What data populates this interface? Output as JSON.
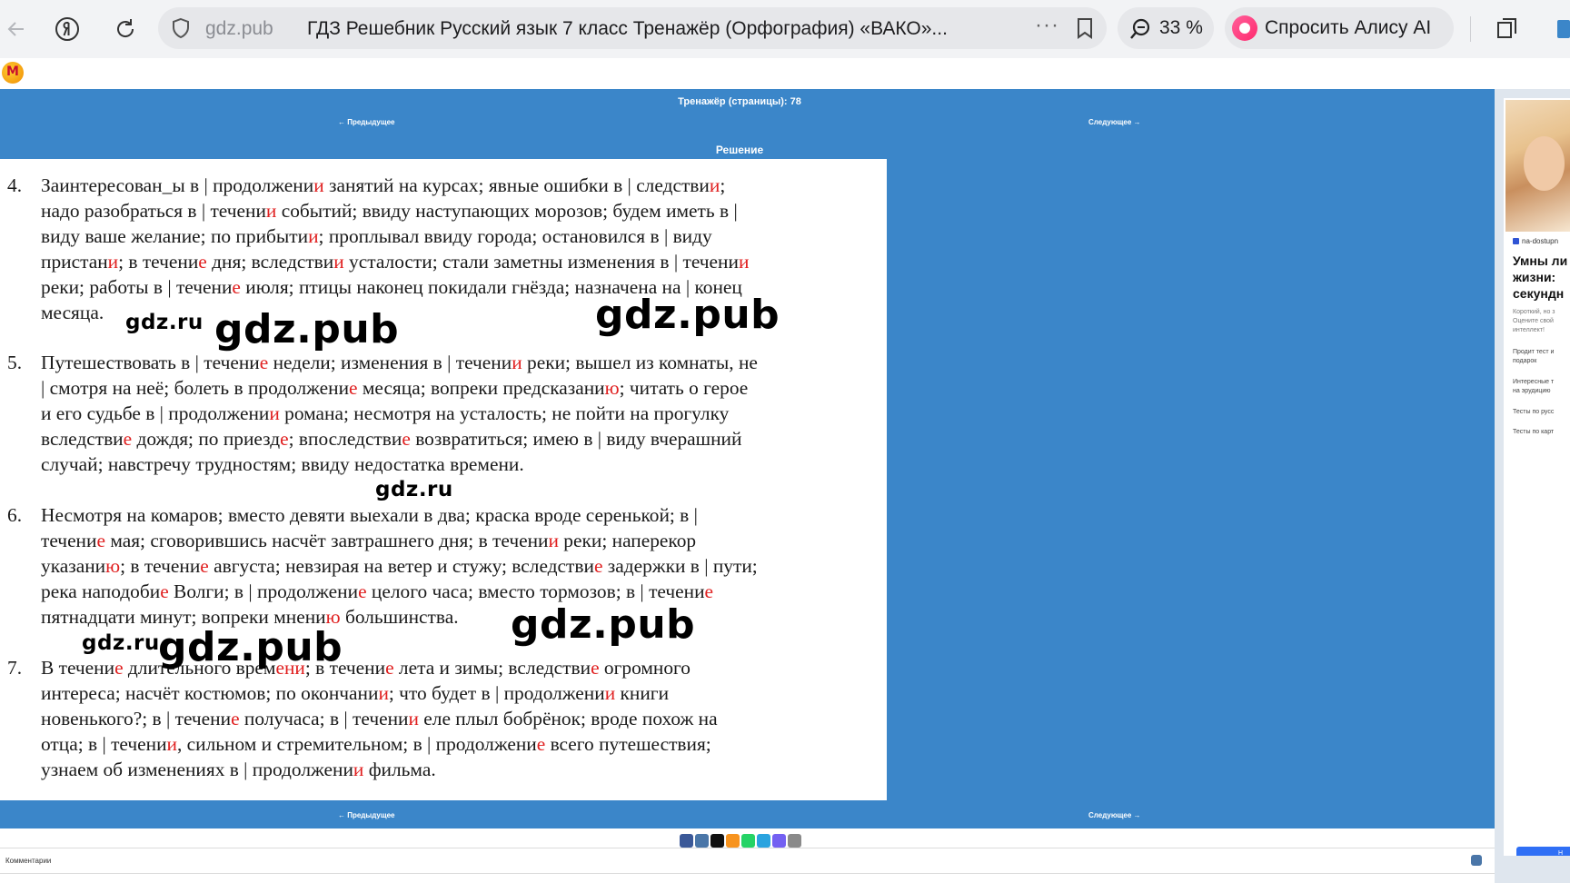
{
  "browser": {
    "domain": "gdz.pub",
    "tab_title": "ГДЗ Решебник Русский язык 7 класс Тренажёр (Орфография) «ВАКО»...",
    "zoom": "33 %",
    "alice_label": "Спросить Алису AI",
    "icons": [
      "back-arrow-icon",
      "yandex-icon",
      "reload-icon",
      "shield-icon",
      "more-icon",
      "bookmark-icon",
      "zoom-icon",
      "alice-icon",
      "collections-icon"
    ]
  },
  "page": {
    "header": "Тренажёр (страницы): 78",
    "prev_label": "← Предыдущее",
    "next_label": "Следующее →",
    "section_label": "Решение",
    "comments_label": "Комментарии"
  },
  "watermarks": {
    "big": "gdz.pub",
    "small": "gdz.ru"
  },
  "solution": {
    "items": [
      {
        "num": "4.",
        "segments": [
          {
            "t": "Заинтересован_ы в | продолжени"
          },
          {
            "t": "и",
            "red": true
          },
          {
            "t": " занятий на курсах; явные ошибки в | следстви"
          },
          {
            "t": "и",
            "red": true
          },
          {
            "t": ";\nнадо разобраться в | течени"
          },
          {
            "t": "и",
            "red": true
          },
          {
            "t": " событий; ввиду наступающих морозов; будем иметь в |\nвиду ваше желание; по прибыти"
          },
          {
            "t": "и",
            "red": true
          },
          {
            "t": "; проплывал ввиду города; остановился в | виду\nпристан"
          },
          {
            "t": "и",
            "red": true
          },
          {
            "t": "; в течени"
          },
          {
            "t": "е",
            "red": true
          },
          {
            "t": " дня; вследстви"
          },
          {
            "t": "и",
            "red": true
          },
          {
            "t": " усталости; стали заметны изменения в | течени"
          },
          {
            "t": "и",
            "red": true
          },
          {
            "t": "\nреки; работы в | течени"
          },
          {
            "t": "е",
            "red": true
          },
          {
            "t": " июля; птицы наконец покидали гнёзда; назначена на | конец\nмесяца."
          }
        ]
      },
      {
        "num": "5.",
        "segments": [
          {
            "t": "Путешествовать в | течени"
          },
          {
            "t": "е",
            "red": true
          },
          {
            "t": " недели; изменения в | течени"
          },
          {
            "t": "и",
            "red": true
          },
          {
            "t": " реки; вышел из комнаты, не\n| смотря на неё; болеть в продолжени"
          },
          {
            "t": "е",
            "red": true
          },
          {
            "t": " месяца; вопреки предсказани"
          },
          {
            "t": "ю",
            "red": true
          },
          {
            "t": "; читать о герое\nи его судьбе в | продолжени"
          },
          {
            "t": "и",
            "red": true
          },
          {
            "t": " романа; несмотря на усталость; не пойти на прогулку\nвследстви"
          },
          {
            "t": "е",
            "red": true
          },
          {
            "t": " дождя; по приезд"
          },
          {
            "t": "е",
            "red": true
          },
          {
            "t": "; впоследстви"
          },
          {
            "t": "е",
            "red": true
          },
          {
            "t": " возвратиться; имею в | виду вчерашний\nслучай; навстречу трудностям; ввиду недостатка времени."
          }
        ]
      },
      {
        "num": "6.",
        "segments": [
          {
            "t": "Несмотря на комаров; вместо девяти выехали в два; краска вроде серенькой; в |\nтечени"
          },
          {
            "t": "е",
            "red": true
          },
          {
            "t": " мая; сговорившись насчёт завтрашнего дня; в течени"
          },
          {
            "t": "и",
            "red": true
          },
          {
            "t": " реки; наперекор\nуказани"
          },
          {
            "t": "ю",
            "red": true
          },
          {
            "t": "; в течени"
          },
          {
            "t": "е",
            "red": true
          },
          {
            "t": " августа; невзирая на ветер и стужу; вследстви"
          },
          {
            "t": "е",
            "red": true
          },
          {
            "t": " задержки в | пути;\nрека наподоби"
          },
          {
            "t": "е",
            "red": true
          },
          {
            "t": " Волги; в | продолжени"
          },
          {
            "t": "е",
            "red": true
          },
          {
            "t": " целого часа; вместо тормозов; в | течени"
          },
          {
            "t": "е",
            "red": true
          },
          {
            "t": "\nпятнадцати минут; вопреки мнени"
          },
          {
            "t": "ю",
            "red": true
          },
          {
            "t": " большинства."
          }
        ]
      },
      {
        "num": "7.",
        "segments": [
          {
            "t": "В течени"
          },
          {
            "t": "е",
            "red": true
          },
          {
            "t": " длительного врем"
          },
          {
            "t": "ени",
            "red": true
          },
          {
            "t": "; в течени"
          },
          {
            "t": "е",
            "red": true
          },
          {
            "t": " лета и зимы; вследстви"
          },
          {
            "t": "е",
            "red": true
          },
          {
            "t": " огромного\nинтереса; насчёт костюмов; по окончани"
          },
          {
            "t": "и",
            "red": true
          },
          {
            "t": "; что будет в | продолжени"
          },
          {
            "t": "и",
            "red": true
          },
          {
            "t": " книги\nновенького?; в | течени"
          },
          {
            "t": "е",
            "red": true
          },
          {
            "t": " получаса; в | течени"
          },
          {
            "t": "и",
            "red": true
          },
          {
            "t": " еле плыл бобрёнок; вроде похож на\nотца; в | течени"
          },
          {
            "t": "и",
            "red": true
          },
          {
            "t": ", сильном и стремительном; в | продолжени"
          },
          {
            "t": "е",
            "red": true
          },
          {
            "t": " всего путешествия;\nузнаем об изменениях в | продолжени"
          },
          {
            "t": "и",
            "red": true
          },
          {
            "t": " фильма."
          }
        ]
      }
    ]
  },
  "ad": {
    "source": "na-dostupn",
    "headline": "Умны ли\nжизни:\nсекундн",
    "desc": "Короткий, но з\nОцените свой\nинтеллект!",
    "links": [
      "Продит тест и\nподарок",
      "Интересные т\nна эрудицию",
      "Тесты по русс",
      "Тесты по карт"
    ],
    "button": "Н"
  },
  "colors": {
    "page_blue": "#3b86c9",
    "accent_red": "#e02020",
    "alice_pink": "#ff2a6e"
  }
}
